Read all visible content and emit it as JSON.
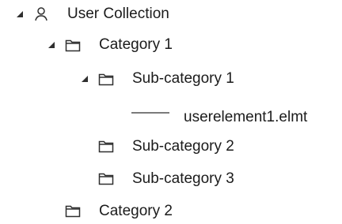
{
  "tree": {
    "root": {
      "label": "User Collection",
      "icon": "user-icon",
      "expanded": true
    },
    "category_1": {
      "label": "Category 1",
      "icon": "folder-icon",
      "expanded": true
    },
    "sub_category_1": {
      "label": "Sub-category 1",
      "icon": "folder-icon",
      "expanded": true
    },
    "element_1": {
      "label": "userelement1.elmt",
      "icon": "file-line-icon"
    },
    "sub_category_2": {
      "label": "Sub-category 2",
      "icon": "folder-icon"
    },
    "sub_category_3": {
      "label": "Sub-category 3",
      "icon": "folder-icon"
    },
    "category_2": {
      "label": "Category 2",
      "icon": "folder-icon"
    }
  },
  "colors": {
    "text": "#1b1b1b",
    "icon_stroke": "#2f2f2f",
    "expander": "#2f2f2f",
    "file_line": "#7b7b7b"
  }
}
